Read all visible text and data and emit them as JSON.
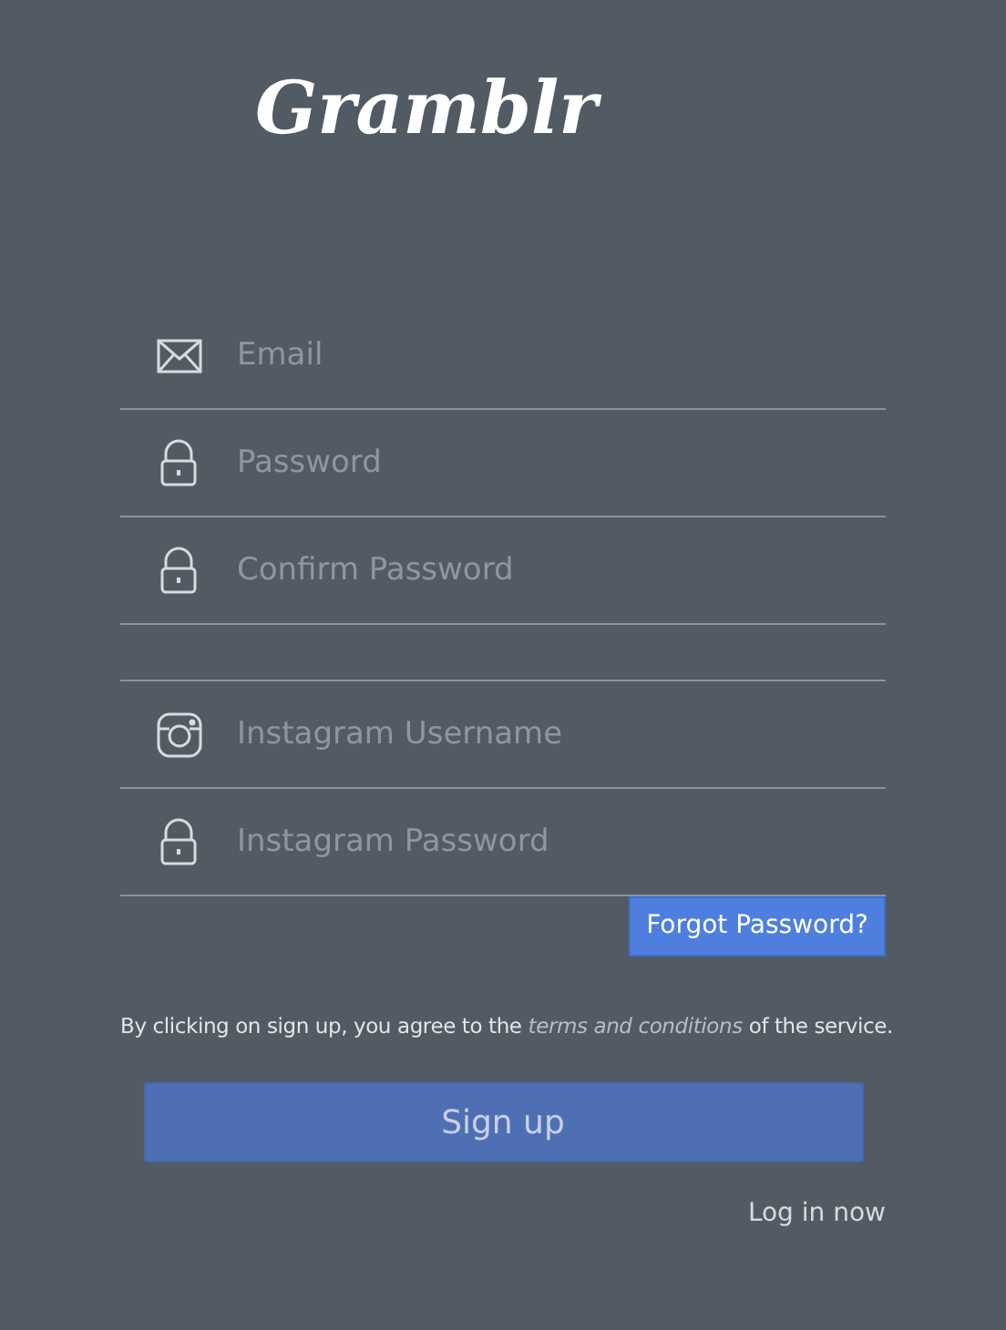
{
  "logo": "Gramblr",
  "account_fields": [
    {
      "kind": "email",
      "placeholder": "Email"
    },
    {
      "kind": "lock",
      "placeholder": "Password"
    },
    {
      "kind": "lock",
      "placeholder": "Confirm Password"
    }
  ],
  "instagram_fields": [
    {
      "kind": "instagram",
      "placeholder": "Instagram Username"
    },
    {
      "kind": "lock",
      "placeholder": "Instagram Password"
    }
  ],
  "forgot_button": "Forgot Password?",
  "terms": {
    "before": "By clicking on sign up, you agree to the",
    "link": "terms and conditions",
    "after": "of the service."
  },
  "signup_button": "Sign up",
  "login_link": "Log in now"
}
